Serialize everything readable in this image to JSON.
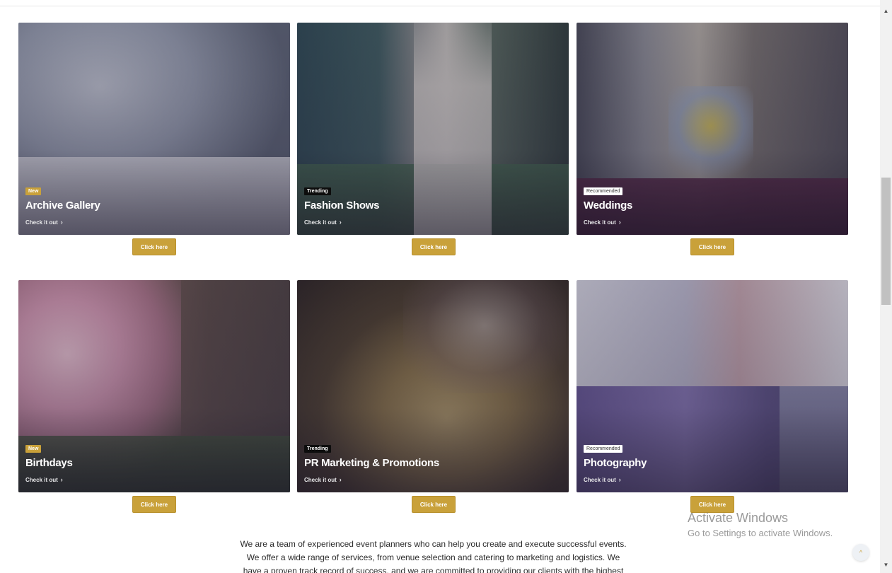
{
  "cards": [
    {
      "badge": "New",
      "badge_type": "new",
      "title": "Archive Gallery",
      "link": "Check it out",
      "button": "Click here"
    },
    {
      "badge": "Trending",
      "badge_type": "trending",
      "title": "Fashion Shows",
      "link": "Check it out",
      "button": "Click here"
    },
    {
      "badge": "Recommended",
      "badge_type": "recommended",
      "title": "Weddings",
      "link": "Check it out",
      "button": "Click here"
    },
    {
      "badge": "New",
      "badge_type": "new",
      "title": "Birthdays",
      "link": "Check it out",
      "button": "Click here"
    },
    {
      "badge": "Trending",
      "badge_type": "trending",
      "title": "PR Marketing & Promotions",
      "link": "Check it out",
      "button": "Click here"
    },
    {
      "badge": "Recommended",
      "badge_type": "recommended",
      "title": "Photography",
      "link": "Check it out",
      "button": "Click here"
    }
  ],
  "about": {
    "line1": "We are a team of experienced event planners who can help you create and execute successful events.",
    "line2": "We offer a wide range of services, from venue selection and catering to marketing and logistics. We",
    "line3": "have a proven track record of success, and we are committed to providing our clients with the highest"
  },
  "watermark": {
    "title": "Activate Windows",
    "subtitle": "Go to Settings to activate Windows."
  },
  "icons": {
    "link_chevron": "chevron-right-icon",
    "scroll_top": "chevron-up-icon"
  },
  "colors": {
    "accent": "#c9a13a",
    "trending_badge": "#0d0d0d"
  }
}
